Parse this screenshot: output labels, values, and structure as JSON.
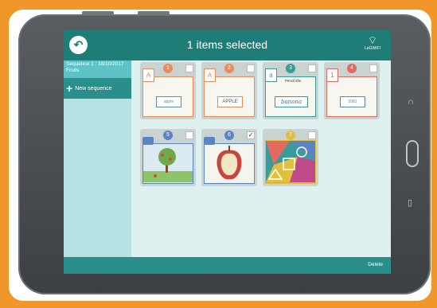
{
  "header": {
    "title": "1 items selected",
    "wifi_label": "LeGWIFI"
  },
  "sidebar": {
    "sequence": {
      "title": "Sequence 1 : 18/10/2017",
      "subtitle": "Fruits"
    },
    "new_sequence_label": "New sequence"
  },
  "footer": {
    "delete_label": "Delete"
  },
  "tiles": [
    {
      "num": "1",
      "letter": "A",
      "word": "apple",
      "selected": false
    },
    {
      "num": "2",
      "letter": "A",
      "word": "APPLE",
      "selected": false
    },
    {
      "num": "3",
      "letter": "a",
      "caption": "Pencil lifts",
      "word": "banana",
      "selected": false
    },
    {
      "num": "4",
      "letter": "1",
      "word": "5981",
      "selected": false
    },
    {
      "num": "5",
      "selected": false
    },
    {
      "num": "6",
      "selected": true,
      "check": "✓"
    },
    {
      "num": "7",
      "selected": false
    }
  ],
  "colors": {
    "topbar": "#1f7d78",
    "tile_bg": "#c9d3d1",
    "badge_orange": "#ec8a5a",
    "badge_blue": "#5b84c4",
    "badge_teal": "#3a9c98",
    "badge_red": "#e36a5e",
    "badge_yellow": "#e0c03c"
  }
}
